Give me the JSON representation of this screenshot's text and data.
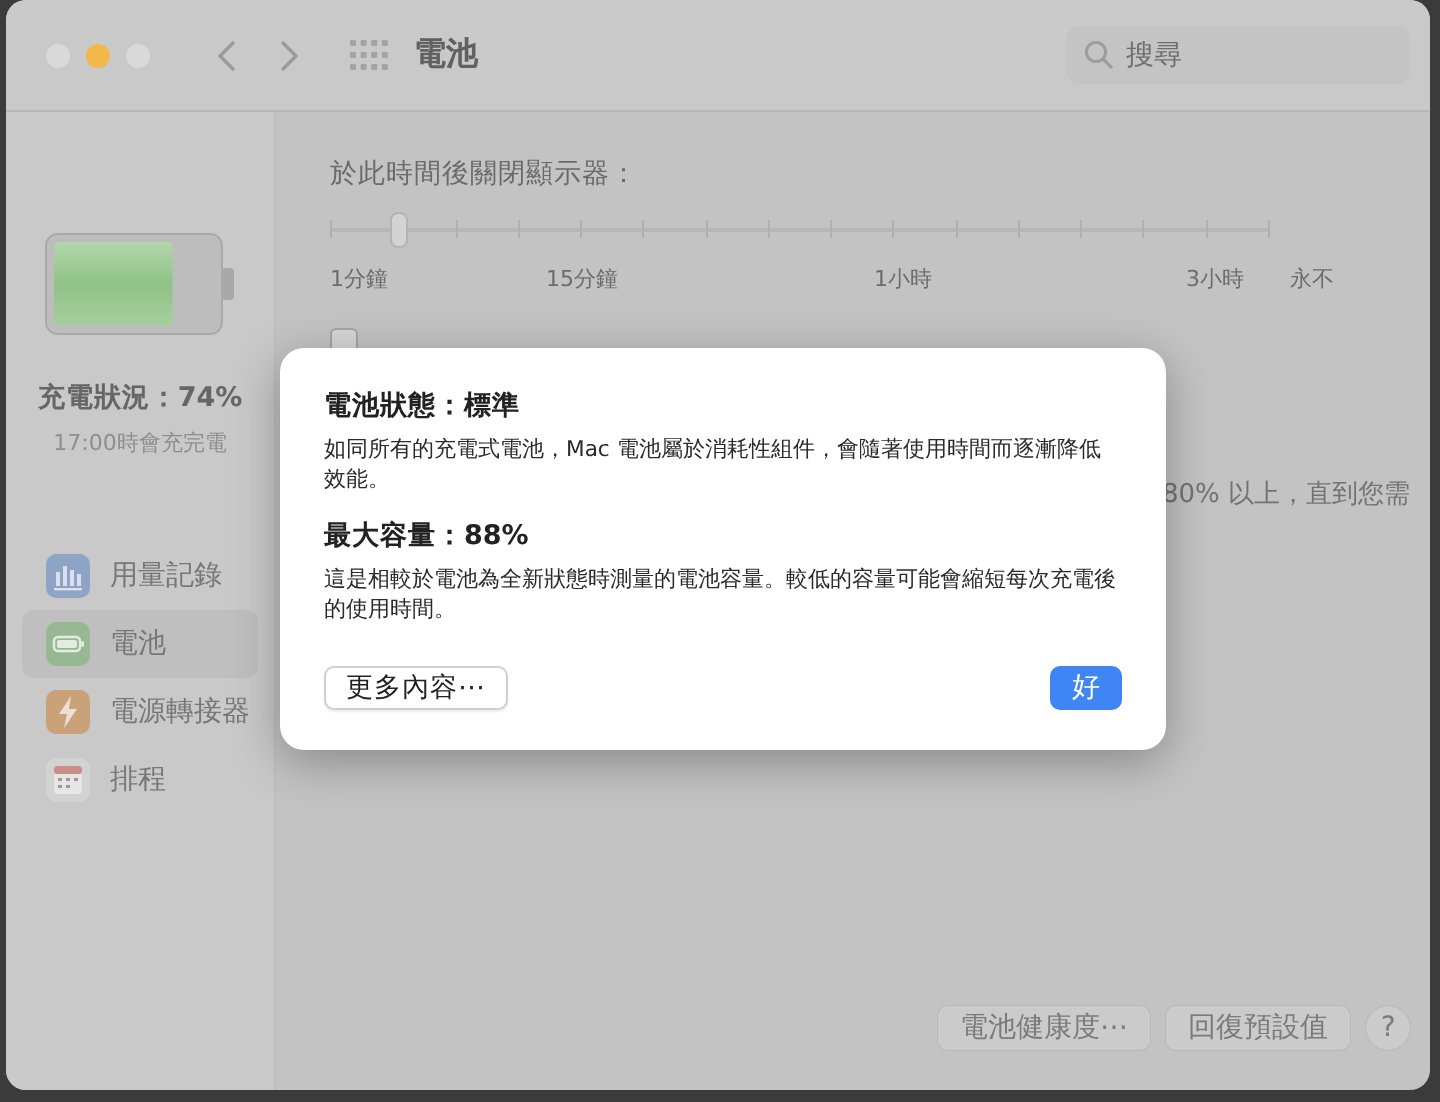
{
  "window": {
    "title": "電池"
  },
  "search": {
    "placeholder": "搜尋"
  },
  "sidebar": {
    "battery": {
      "level": 0.74
    },
    "charge_status": "充電狀況：74%",
    "charge_time": "17:00時會充完電",
    "items": [
      {
        "label": "用量記錄",
        "kind": "usage",
        "selected": false
      },
      {
        "label": "電池",
        "kind": "battery",
        "selected": true
      },
      {
        "label": "電源轉接器",
        "kind": "adapter",
        "selected": false
      },
      {
        "label": "排程",
        "kind": "schedule",
        "selected": false
      }
    ]
  },
  "main": {
    "display_off": {
      "label": "於此時間後關閉顯示器：",
      "level": 0.075,
      "ticks": [
        "1分鐘",
        "15分鐘",
        "1小時",
        "3小時",
        "永不"
      ]
    },
    "dim_checkbox": {
      "checked": false
    },
    "partial_text": "80% 以上，直到您需",
    "buttons": [
      "電池健康度⋯",
      "回復預設值"
    ],
    "help": "?"
  },
  "dialog": {
    "sections": [
      {
        "title": "電池狀態：標準",
        "body": "如同所有的充電式電池，Mac 電池屬於消耗性組件，會隨著使用時間而逐漸降低效能。"
      },
      {
        "title": "最大容量：88%",
        "body": "這是相較於電池為全新狀態時測量的電池容量。較低的容量可能會縮短每次充電後的使用時間。"
      }
    ],
    "more_button": "更多內容⋯",
    "ok_button": "好"
  }
}
